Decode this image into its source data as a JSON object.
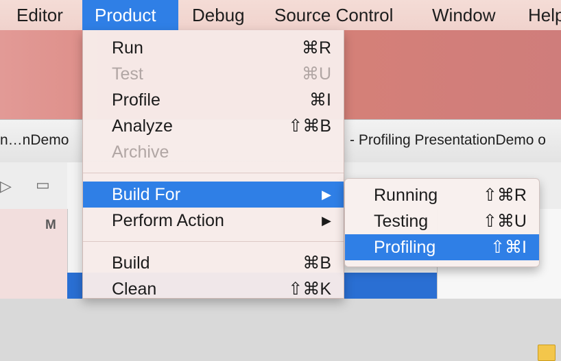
{
  "menubar": {
    "items": [
      "Editor",
      "Product",
      "Debug",
      "Source Control",
      "Window",
      "Help"
    ]
  },
  "window": {
    "tab_left": "n…nDemo",
    "tab_right": "- Profiling PresentationDemo o",
    "sidebar_label": "M"
  },
  "product_menu": {
    "items": [
      {
        "label": "Run",
        "shortcut": "⌘R"
      },
      {
        "label": "Test",
        "shortcut": "⌘U"
      },
      {
        "label": "Profile",
        "shortcut": "⌘I"
      },
      {
        "label": "Analyze",
        "shortcut": "⇧⌘B"
      },
      {
        "label": "Archive",
        "shortcut": ""
      },
      {
        "label": "Build For",
        "shortcut": "▶"
      },
      {
        "label": "Perform Action",
        "shortcut": "▶"
      },
      {
        "label": "Build",
        "shortcut": "⌘B"
      },
      {
        "label": "Clean",
        "shortcut": "⇧⌘K"
      }
    ]
  },
  "build_for_submenu": {
    "items": [
      {
        "label": "Running",
        "shortcut": "⇧⌘R"
      },
      {
        "label": "Testing",
        "shortcut": "⇧⌘U"
      },
      {
        "label": "Profiling",
        "shortcut": "⇧⌘I"
      }
    ]
  },
  "colors": {
    "accent": "#2f7fe6",
    "menu_bg": "#f7ebe9",
    "disabled_text": "#b1a6a4"
  }
}
